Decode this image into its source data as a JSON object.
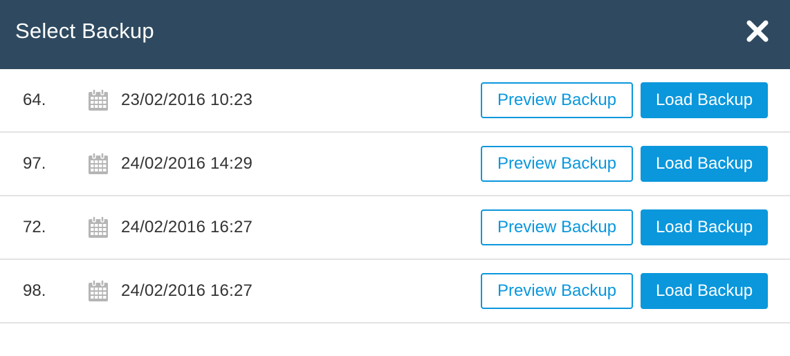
{
  "dialog": {
    "title": "Select Backup",
    "close_icon": "close-icon"
  },
  "colors": {
    "header_bg": "#2f4a60",
    "accent": "#0a97dc",
    "divider": "#e3e3e3"
  },
  "backups": [
    {
      "number": "64.",
      "datetime": "23/02/2016 10:23",
      "icon": "calendar-icon",
      "preview_label": "Preview Backup",
      "load_label": "Load Backup"
    },
    {
      "number": "97.",
      "datetime": "24/02/2016 14:29",
      "icon": "calendar-icon",
      "preview_label": "Preview Backup",
      "load_label": "Load Backup"
    },
    {
      "number": "72.",
      "datetime": "24/02/2016 16:27",
      "icon": "calendar-icon",
      "preview_label": "Preview Backup",
      "load_label": "Load Backup"
    },
    {
      "number": "98.",
      "datetime": "24/02/2016 16:27",
      "icon": "calendar-icon",
      "preview_label": "Preview Backup",
      "load_label": "Load Backup"
    }
  ]
}
